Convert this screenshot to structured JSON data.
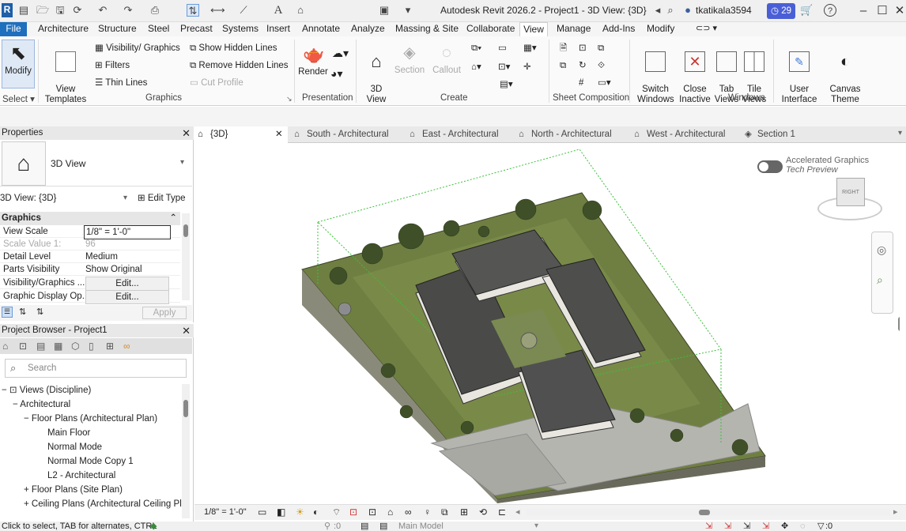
{
  "window": {
    "title": "Autodesk Revit 2026.2 - Project1 - 3D View: {3D}",
    "user": "tkatikala3594",
    "notifications": "29"
  },
  "menu": {
    "file": "File",
    "tabs": [
      "Architecture",
      "Structure",
      "Steel",
      "Precast",
      "Systems",
      "Insert",
      "Annotate",
      "Analyze",
      "Massing & Site",
      "Collaborate",
      "View",
      "Manage",
      "Add-Ins",
      "Modify"
    ]
  },
  "ribbon": {
    "select": {
      "modify": "Modify",
      "label": "Select"
    },
    "graphics": {
      "view_templates": "View\nTemplates",
      "vis_graphics": "Visibility/ Graphics",
      "filters": "Filters",
      "thin_lines": "Thin  Lines",
      "show_hidden": "Show  Hidden Lines",
      "remove_hidden": "Remove  Hidden Lines",
      "cut_profile": "Cut  Profile",
      "label": "Graphics"
    },
    "presentation": {
      "render": "Render",
      "label": "Presentation"
    },
    "create": {
      "view3d": "3D\nView",
      "section": "Section",
      "callout": "Callout",
      "label": "Create"
    },
    "sheet": {
      "label": "Sheet Composition"
    },
    "windows": {
      "switch": "Switch\nWindows",
      "close_inactive": "Close\nInactive",
      "tab_views": "Tab\nViews",
      "tile_views": "Tile\nViews",
      "label": "Windows"
    },
    "ui": {
      "user_interface": "User\nInterface",
      "canvas_theme": "Canvas\nTheme"
    }
  },
  "properties": {
    "title": "Properties",
    "type_name": "3D View",
    "instance_selector": "3D View: {3D}",
    "edit_type": "Edit Type",
    "section_graphics": "Graphics",
    "rows": [
      {
        "key": "View Scale",
        "value": "1/8\" = 1'-0\""
      },
      {
        "key": "Scale Value   1:",
        "value": "96"
      },
      {
        "key": "Detail Level",
        "value": "Medium"
      },
      {
        "key": "Parts Visibility",
        "value": "Show Original"
      },
      {
        "key": "Visibility/Graphics ...",
        "value": "Edit..."
      },
      {
        "key": "Graphic Display Op...",
        "value": "Edit..."
      }
    ],
    "apply": "Apply"
  },
  "browser": {
    "title": "Project Browser - Project1",
    "search_placeholder": "Search",
    "items": [
      "Views (Discipline)",
      "Architectural",
      "Floor Plans (Architectural Plan)",
      "Main Floor",
      "Normal Mode",
      "Normal Mode Copy 1",
      "L2 - Architectural",
      "Floor Plans (Site Plan)",
      "Ceiling Plans (Architectural Ceiling Pla"
    ]
  },
  "view_tabs": [
    "{3D}",
    "South - Architectural",
    "East - Architectural",
    "North - Architectural",
    "West - Architectural",
    "Section 1"
  ],
  "canvas": {
    "accel_title": "Accelerated Graphics",
    "accel_sub": "Tech Preview",
    "viewcube_face": "RIGHT"
  },
  "viewbar": {
    "scale": "1/8\" = 1'-0\""
  },
  "status": {
    "text": "Click to select, TAB for alternates, CTRL",
    "model": "Main Model",
    "zero1": ":0",
    "zero2": ":0"
  }
}
